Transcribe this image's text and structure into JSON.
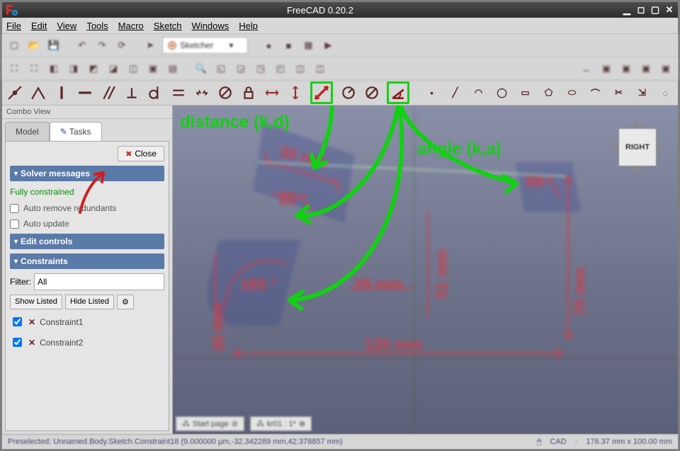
{
  "titlebar": {
    "title": "FreeCAD 0.20.2"
  },
  "menubar": {
    "items": [
      "File",
      "Edit",
      "View",
      "Tools",
      "Macro",
      "Sketch",
      "Windows",
      "Help"
    ]
  },
  "workbench": {
    "selected": "Sketcher"
  },
  "combo": {
    "title": "Combo View",
    "tabs": {
      "model": "Model",
      "tasks": "Tasks"
    },
    "close": "Close",
    "solver_section": "Solver messages",
    "solver_status": "Fully constrained",
    "auto_remove": "Auto remove redundants",
    "auto_update": "Auto update",
    "edit_section": "Edit controls",
    "constraints_section": "Constraints",
    "filter_label": "Filter:",
    "filter_value": "All",
    "show_listed": "Show Listed",
    "hide_listed": "Hide Listed",
    "constraint1": "Constraint1",
    "constraint2": "Constraint2"
  },
  "viewport": {
    "dim_30mm_top": "30 mm",
    "dim_80deg": "80 °",
    "dim_165deg": "165 °",
    "dim_30mm_left": "30 mm",
    "dim_120mm": "120 mm",
    "dim_70mm": "70 mm",
    "dim_29mm": "29 mm",
    "dim_51mm": "51 mm",
    "dim_50deg": "50 °",
    "navcube_face": "RIGHT"
  },
  "annotations": {
    "distance": "distance (k,d)",
    "angle": "angle (k,a)"
  },
  "doctabs": {
    "start": "Start page",
    "sketch": "kr01 : 1*"
  },
  "statusbar": {
    "preselected": "Preselected: Unnamed.Body.Sketch.Constraint18 (9.000000 µm,-32.342289 mm,42.378857 mm)",
    "nav": "CAD",
    "size": "176.37 mm x 100.00 mm"
  }
}
